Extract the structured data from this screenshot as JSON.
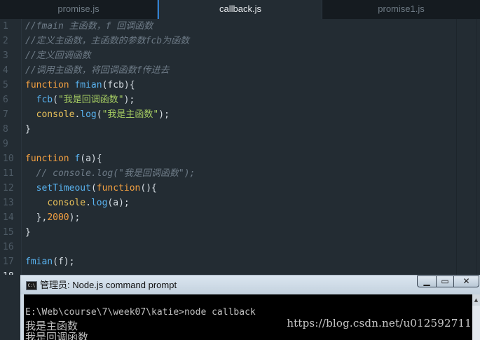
{
  "tabs": [
    {
      "label": "promise.js",
      "active": false
    },
    {
      "label": "callback.js",
      "active": true
    },
    {
      "label": "promise1.js",
      "active": false
    }
  ],
  "editor": {
    "current_line": 18,
    "lines": [
      {
        "n": "1",
        "tokens": [
          {
            "t": "//fmain 主函数，f 回调函数",
            "c": "c"
          }
        ]
      },
      {
        "n": "2",
        "tokens": [
          {
            "t": "//定义主函数，主函数的参数fcb为函数",
            "c": "c"
          }
        ]
      },
      {
        "n": "3",
        "tokens": [
          {
            "t": "//定义回调函数",
            "c": "c"
          }
        ]
      },
      {
        "n": "4",
        "tokens": [
          {
            "t": "//调用主函数，将回调函数f传进去",
            "c": "c"
          }
        ]
      },
      {
        "n": "5",
        "tokens": [
          {
            "t": "function",
            "c": "kw"
          },
          {
            "t": " ",
            "c": ""
          },
          {
            "t": "fmian",
            "c": "fn"
          },
          {
            "t": "(fcb){",
            "c": ""
          }
        ]
      },
      {
        "n": "6",
        "tokens": [
          {
            "t": "  ",
            "c": ""
          },
          {
            "t": "fcb",
            "c": "fn"
          },
          {
            "t": "(",
            "c": ""
          },
          {
            "t": "\"我是回调函数\"",
            "c": "st"
          },
          {
            "t": ");",
            "c": ""
          }
        ]
      },
      {
        "n": "7",
        "tokens": [
          {
            "t": "  ",
            "c": ""
          },
          {
            "t": "console",
            "c": "gd"
          },
          {
            "t": ".",
            "c": ""
          },
          {
            "t": "log",
            "c": "fn"
          },
          {
            "t": "(",
            "c": ""
          },
          {
            "t": "\"我是主函数\"",
            "c": "st"
          },
          {
            "t": ");",
            "c": ""
          }
        ]
      },
      {
        "n": "8",
        "tokens": [
          {
            "t": "}",
            "c": ""
          }
        ]
      },
      {
        "n": "9",
        "tokens": []
      },
      {
        "n": "10",
        "tokens": [
          {
            "t": "function",
            "c": "kw"
          },
          {
            "t": " ",
            "c": ""
          },
          {
            "t": "f",
            "c": "fn"
          },
          {
            "t": "(a){",
            "c": ""
          }
        ]
      },
      {
        "n": "11",
        "tokens": [
          {
            "t": "  ",
            "c": ""
          },
          {
            "t": "// console.log(\"我是回调函数\");",
            "c": "c"
          }
        ]
      },
      {
        "n": "12",
        "tokens": [
          {
            "t": "  ",
            "c": ""
          },
          {
            "t": "setTimeout",
            "c": "fn"
          },
          {
            "t": "(",
            "c": ""
          },
          {
            "t": "function",
            "c": "kw"
          },
          {
            "t": "(){",
            "c": ""
          }
        ]
      },
      {
        "n": "13",
        "tokens": [
          {
            "t": "    ",
            "c": ""
          },
          {
            "t": "console",
            "c": "gd"
          },
          {
            "t": ".",
            "c": ""
          },
          {
            "t": "log",
            "c": "fn"
          },
          {
            "t": "(a);",
            "c": ""
          }
        ]
      },
      {
        "n": "14",
        "tokens": [
          {
            "t": "  },",
            "c": ""
          },
          {
            "t": "2000",
            "c": "nm"
          },
          {
            "t": ");",
            "c": ""
          }
        ]
      },
      {
        "n": "15",
        "tokens": [
          {
            "t": "}",
            "c": ""
          }
        ]
      },
      {
        "n": "16",
        "tokens": []
      },
      {
        "n": "17",
        "tokens": [
          {
            "t": "fmian",
            "c": "fn"
          },
          {
            "t": "(f);",
            "c": ""
          }
        ]
      },
      {
        "n": "18",
        "tokens": []
      }
    ]
  },
  "cmd": {
    "title": "管理员: Node.js command prompt",
    "icon_label": "C:\\",
    "buttons": {
      "minimize": "▁",
      "maximize": "▭",
      "close": "✕"
    },
    "lines": [
      "",
      "E:\\Web\\course\\7\\week07\\katie>node callback",
      "我是主函数",
      "我是回调函数"
    ]
  },
  "watermark": "https://blog.csdn.net/u012592711",
  "colors": {
    "editor_bg": "#232c33",
    "tab_bg": "#151b20",
    "keyword": "#f3a041",
    "function": "#59b3f0",
    "string": "#a5cc62",
    "comment": "#6d7a86"
  }
}
